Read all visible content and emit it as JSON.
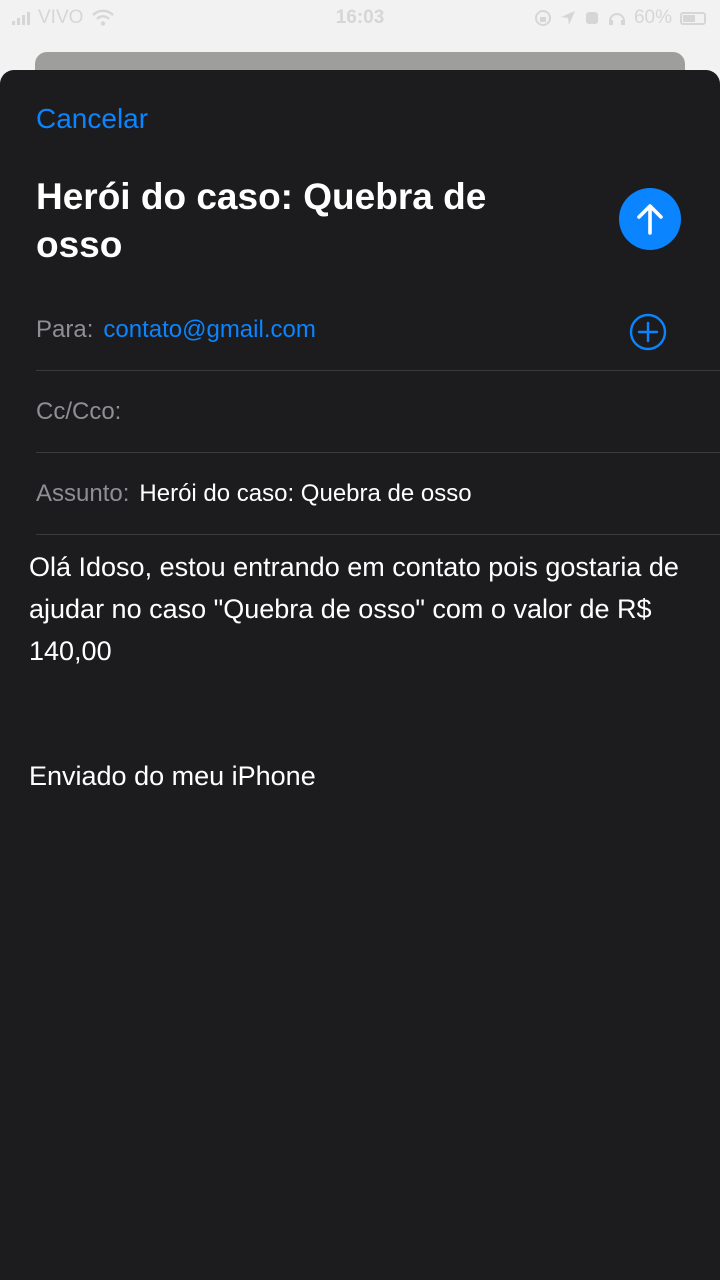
{
  "status_bar": {
    "carrier": "VIVO",
    "time": "16:03",
    "battery": "60%"
  },
  "compose": {
    "cancel_label": "Cancelar",
    "title": "Herói do caso: Quebra de osso",
    "to_label": "Para:",
    "to_value": "contato@gmail.com",
    "cc_label": "Cc/Cco:",
    "subject_label": "Assunto:",
    "subject_value": "Herói do caso: Quebra de osso",
    "body": "Olá Idoso, estou entrando em contato pois gostaria de ajudar no caso \"Quebra de osso\" com o valor de R$ 140,00",
    "signature": "Enviado do meu iPhone"
  },
  "icons": {
    "send": "arrow-up-icon",
    "add_contact": "plus-circle-icon"
  },
  "colors": {
    "accent": "#0a84ff",
    "sheet_background": "#1c1c1e",
    "label_gray": "#8e8e93"
  }
}
